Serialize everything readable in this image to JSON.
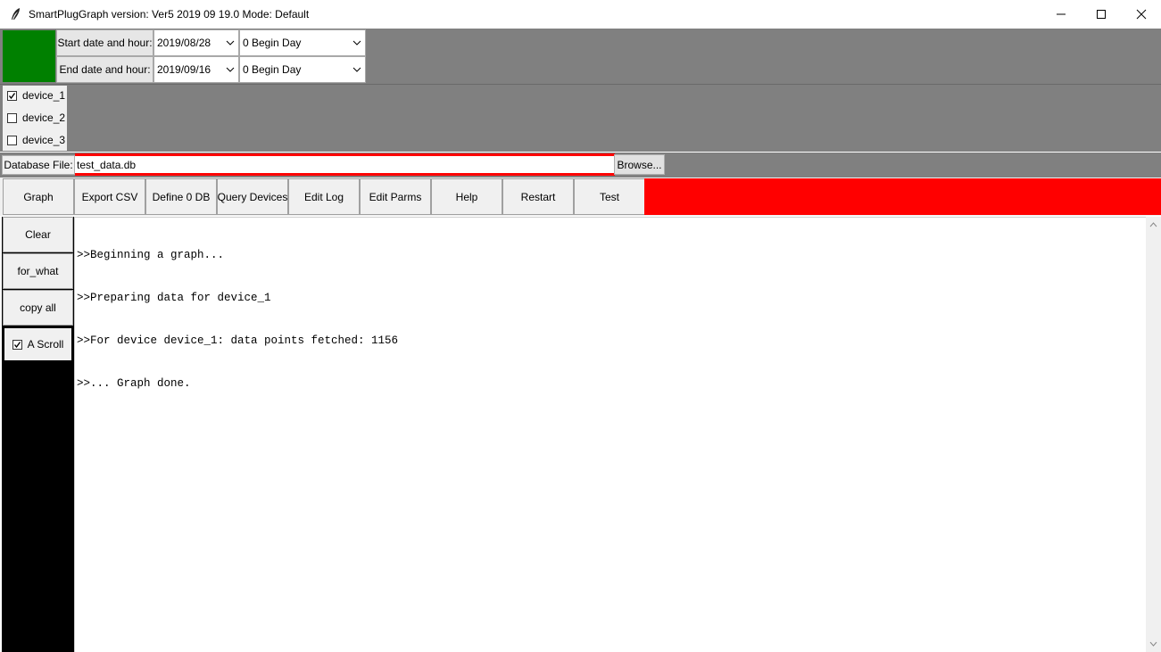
{
  "window": {
    "title": "SmartPlugGraph  version: Ver5 2019 09 19.0 Mode: Default",
    "app_icon": "feather-icon",
    "controls": [
      "minimize-icon",
      "maximize-icon",
      "close-icon"
    ]
  },
  "dates": {
    "start_label": "Start date and hour:",
    "start_date": "2019/08/28",
    "start_hour": "0 Begin Day",
    "end_label": "End date and hour:",
    "end_date": "2019/09/16",
    "end_hour": "0 Begin Day"
  },
  "devices": [
    {
      "label": "device_1",
      "checked": true
    },
    {
      "label": "device_2",
      "checked": false
    },
    {
      "label": "device_3",
      "checked": false
    }
  ],
  "database": {
    "label": "Database File:",
    "value": "test_data.db",
    "browse_label": "Browse..."
  },
  "toolbar": {
    "buttons": [
      "Graph",
      "Export CSV",
      "Define 0 DB",
      "Query Devices",
      "Edit Log",
      "Edit Parms",
      "Help",
      "Restart",
      "Test"
    ]
  },
  "sidebar": {
    "clear": "Clear",
    "for_what": "for_what",
    "copy_all": "copy all",
    "auto_scroll": "A Scroll",
    "auto_scroll_checked": true
  },
  "log": {
    "lines": [
      ">>Beginning a graph...",
      ">>Preparing data for device_1",
      ">>For device device_1: data points fetched: 1156",
      ">>... Graph done."
    ]
  },
  "colors": {
    "status_indicator": "#008000",
    "status_bar": "#ff0000",
    "panel_bg": "#808080"
  }
}
